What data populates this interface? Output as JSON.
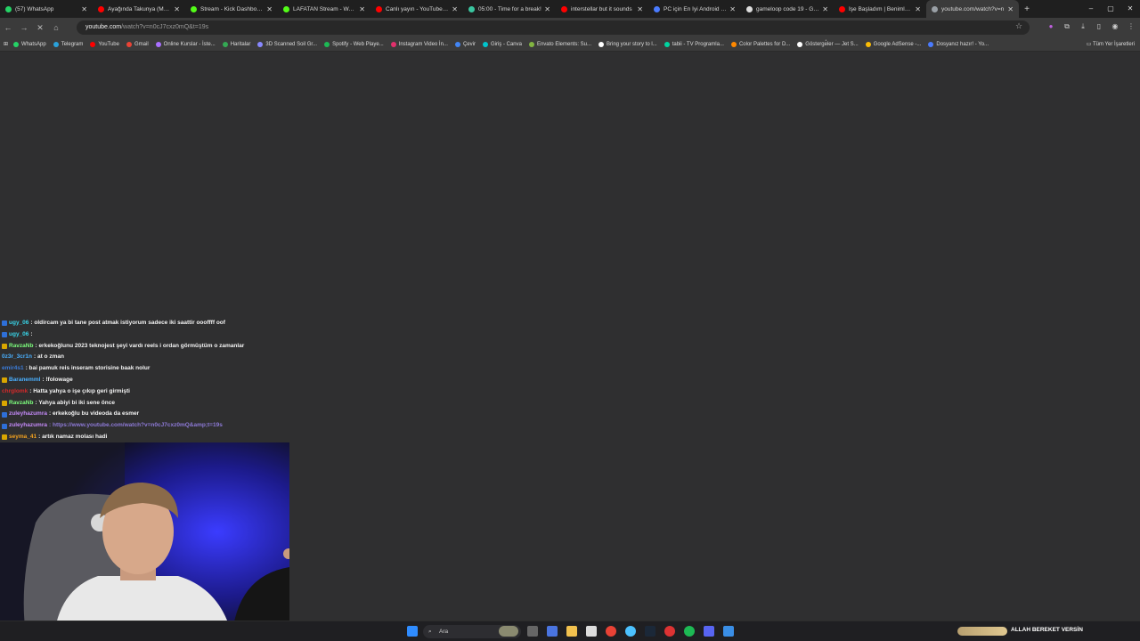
{
  "tabs": [
    {
      "label": "(57) WhatsApp",
      "color": "#25d366"
    },
    {
      "label": "Ayağında Takunya (Madu",
      "color": "#ff0000"
    },
    {
      "label": "Stream - Kick Dashboard",
      "color": "#53fc18"
    },
    {
      "label": "LAFATAN Stream - Watch",
      "color": "#53fc18"
    },
    {
      "label": "Canlı yayın - YouTube Stu",
      "color": "#ff0000"
    },
    {
      "label": "05:00 - Time for a break!",
      "color": "#3ac6a0"
    },
    {
      "label": "interstellar but it sounds",
      "color": "#ff0000"
    },
    {
      "label": "PC için En İyi Android Em",
      "color": "#4a7bff"
    },
    {
      "label": "gameloop code 19 - Goo",
      "color": "#dddddd"
    },
    {
      "label": "İşe Başladım | Benimle bi",
      "color": "#ff0000"
    },
    {
      "label": "youtube.com/watch?v=n",
      "color": "#9aa0a6"
    }
  ],
  "address": {
    "host": "youtube.com",
    "path": "/watch?v=n0cJ7cxz0mQ&t=19s"
  },
  "bookmarks": [
    {
      "label": "WhatsApp",
      "color": "#25d366"
    },
    {
      "label": "Telegram",
      "color": "#2aa1da"
    },
    {
      "label": "YouTube",
      "color": "#ff0000"
    },
    {
      "label": "Gmail",
      "color": "#ea4335"
    },
    {
      "label": "Online Kurslar - İste...",
      "color": "#a970ff"
    },
    {
      "label": "Haritalar",
      "color": "#34a853"
    },
    {
      "label": "3D Scanned Soil Gr...",
      "color": "#8888ff"
    },
    {
      "label": "Spotify - Web Playe...",
      "color": "#1db954"
    },
    {
      "label": "Instagram Video İn...",
      "color": "#e1306c"
    },
    {
      "label": "Çevir",
      "color": "#4285f4"
    },
    {
      "label": "Giriş - Canva",
      "color": "#00c4cc"
    },
    {
      "label": "Envato Elements: Su...",
      "color": "#82b541"
    },
    {
      "label": "Bring your story to l...",
      "color": "#ffffff"
    },
    {
      "label": "tabii - TV Programla...",
      "color": "#00d4a0"
    },
    {
      "label": "Color Palettes for D...",
      "color": "#ff8800"
    },
    {
      "label": "Gösterge̊ler — Jet S...",
      "color": "#ffffff"
    },
    {
      "label": "Google AdSense -...",
      "color": "#fbbc05"
    },
    {
      "label": "Dosyanız hazır! - Yo...",
      "color": "#4a7bff"
    }
  ],
  "bookmarks_end": "Tüm Yer İşaretleri",
  "chat": [
    {
      "user": "ugy_06",
      "text": ": oldircam ya bi tane post atmak istiyorum sadece iki saattir oooffff oof",
      "color": "#38d4e8",
      "badge": "#2e6fd8"
    },
    {
      "user": "ugy_06",
      "text": ":",
      "color": "#38d4e8",
      "badge": "#2e6fd8"
    },
    {
      "user": "RavzaNb",
      "text": ": erkekoğlunu 2023 teknojest şeyi vardı reels i ordan görmüştüm o zamanlar",
      "color": "#7cfc7c",
      "badge": "#d9a600"
    },
    {
      "user": "0z3r_3cr1n",
      "text": ": at o zman",
      "color": "#4ab0ff",
      "badge": ""
    },
    {
      "user": "emir4s1",
      "text": ": bai pamuk reis inseram storisine baak nolur",
      "color": "#3b7bd8",
      "badge": ""
    },
    {
      "user": "Baranemml",
      "text": ": !folowage",
      "color": "#4ab0ff",
      "badge": "#d9a600"
    },
    {
      "user": "chrglomk",
      "text": ": Hatta yahya o işe çıkıp geri girmişti",
      "color": "#d42a2a",
      "badge": ""
    },
    {
      "user": "RavzaNb",
      "text": ": Yahya abiyi bi iki sene önce",
      "color": "#7cfc7c",
      "badge": "#d9a600"
    },
    {
      "user": "zuleyhazumra",
      "text": ": erkekoğlu bu videoda da esmer",
      "color": "#c58af9",
      "badge": "#2e6fd8"
    },
    {
      "user": "zuleyhazumra",
      "text": ": https://www.youtube.com/watch?v=n0cJ7cxz0mQ&amp;t=19s",
      "color": "#c58af9",
      "badge": "#2e6fd8",
      "link": true
    },
    {
      "user": "seyma_41",
      "text": ": artık namaz molası hadi",
      "color": "#f0a020",
      "badge": "#d9a600"
    }
  ],
  "taskbar": {
    "search_label": "Ara",
    "tray_text": "ALLAH BEREKET VERSİN"
  }
}
